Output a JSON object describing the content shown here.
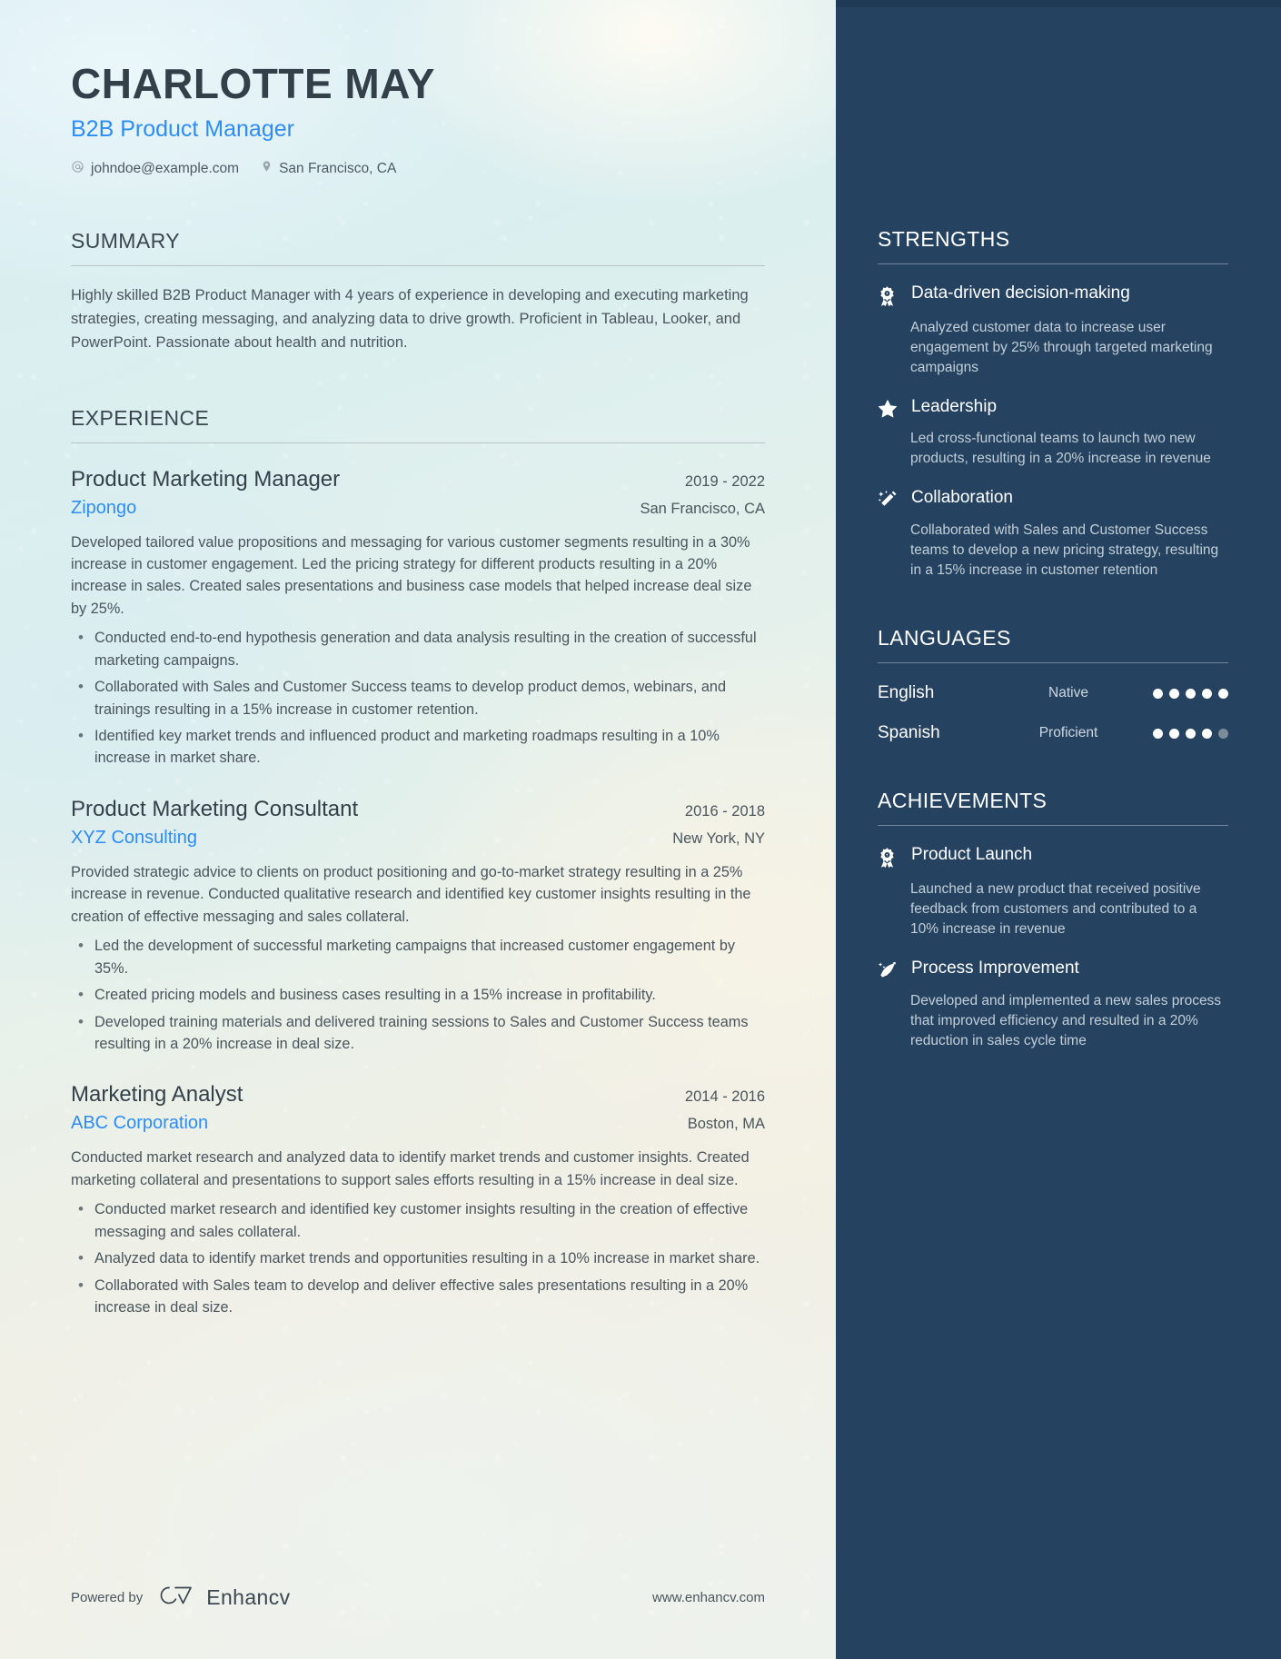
{
  "header": {
    "name": "CHARLOTTE MAY",
    "job_title": "B2B Product Manager",
    "email": "johndoe@example.com",
    "location": "San Francisco, CA",
    "email_icon": "at-sign-icon",
    "location_icon": "map-pin-icon"
  },
  "summary": {
    "title": "SUMMARY",
    "text": "Highly skilled B2B Product Manager with 4 years of experience in developing and executing marketing strategies, creating messaging, and analyzing data to drive growth. Proficient in Tableau, Looker, and PowerPoint. Passionate about health and nutrition."
  },
  "experience": {
    "title": "EXPERIENCE",
    "entries": [
      {
        "role": "Product Marketing Manager",
        "date": "2019 - 2022",
        "company": "Zipongo",
        "location": "San Francisco, CA",
        "description": "Developed tailored value propositions and messaging for various customer segments resulting in a 30% increase in customer engagement. Led the pricing strategy for different products resulting in a 20% increase in sales. Created sales presentations and business case models that helped increase deal size by 25%.",
        "bullets": [
          "Conducted end-to-end hypothesis generation and data analysis resulting in the creation of successful marketing campaigns.",
          "Collaborated with Sales and Customer Success teams to develop product demos, webinars, and trainings resulting in a 15% increase in customer retention.",
          "Identified key market trends and influenced product and marketing roadmaps resulting in a 10% increase in market share."
        ]
      },
      {
        "role": "Product Marketing Consultant",
        "date": "2016 - 2018",
        "company": "XYZ Consulting",
        "location": "New York, NY",
        "description": "Provided strategic advice to clients on product positioning and go-to-market strategy resulting in a 25% increase in revenue. Conducted qualitative research and identified key customer insights resulting in the creation of effective messaging and sales collateral.",
        "bullets": [
          "Led the development of successful marketing campaigns that increased customer engagement by 35%.",
          "Created pricing models and business cases resulting in a 15% increase in profitability.",
          "Developed training materials and delivered training sessions to Sales and Customer Success teams resulting in a 20% increase in deal size."
        ]
      },
      {
        "role": "Marketing Analyst",
        "date": "2014 - 2016",
        "company": "ABC Corporation",
        "location": "Boston, MA",
        "description": "Conducted market research and analyzed data to identify market trends and customer insights. Created marketing collateral and presentations to support sales efforts resulting in a 15% increase in deal size.",
        "bullets": [
          "Conducted market research and identified key customer insights resulting in the creation of effective messaging and sales collateral.",
          "Analyzed data to identify market trends and opportunities resulting in a 10% increase in market share.",
          "Collaborated with Sales team to develop and deliver effective sales presentations resulting in a 20% increase in deal size."
        ]
      }
    ]
  },
  "strengths": {
    "title": "STRENGTHS",
    "items": [
      {
        "icon": "award-ribbon-icon",
        "name": "Data-driven decision-making",
        "desc": "Analyzed customer data to increase user engagement by 25% through targeted marketing campaigns"
      },
      {
        "icon": "star-icon",
        "name": "Leadership",
        "desc": "Led cross-functional teams to launch two new products, resulting in a 20% increase in revenue"
      },
      {
        "icon": "magic-wand-icon",
        "name": "Collaboration",
        "desc": "Collaborated with Sales and Customer Success teams to develop a new pricing strategy, resulting in a 15% increase in customer retention"
      }
    ]
  },
  "languages": {
    "title": "LANGUAGES",
    "items": [
      {
        "name": "English",
        "level": "Native",
        "filled": 5,
        "total": 5
      },
      {
        "name": "Spanish",
        "level": "Proficient",
        "filled": 4,
        "total": 5
      }
    ]
  },
  "achievements": {
    "title": "ACHIEVEMENTS",
    "items": [
      {
        "icon": "award-ribbon-icon",
        "name": "Product Launch",
        "desc": "Launched a new product that received positive feedback from customers and contributed to a 10% increase in revenue"
      },
      {
        "icon": "trending-up-icon",
        "name": "Process Improvement",
        "desc": "Developed and implemented a new sales process that improved efficiency and resulted in a 20% reduction in sales cycle time"
      }
    ]
  },
  "footer": {
    "powered_by": "Powered by",
    "brand": "Enhancv",
    "brand_icon": "enhancv-logo-icon",
    "url": "www.enhancv.com"
  },
  "colors": {
    "accent_blue": "#2d8cf5",
    "sidebar_bg": "#254360",
    "heading": "#33404a",
    "body_text": "#4a555d"
  }
}
